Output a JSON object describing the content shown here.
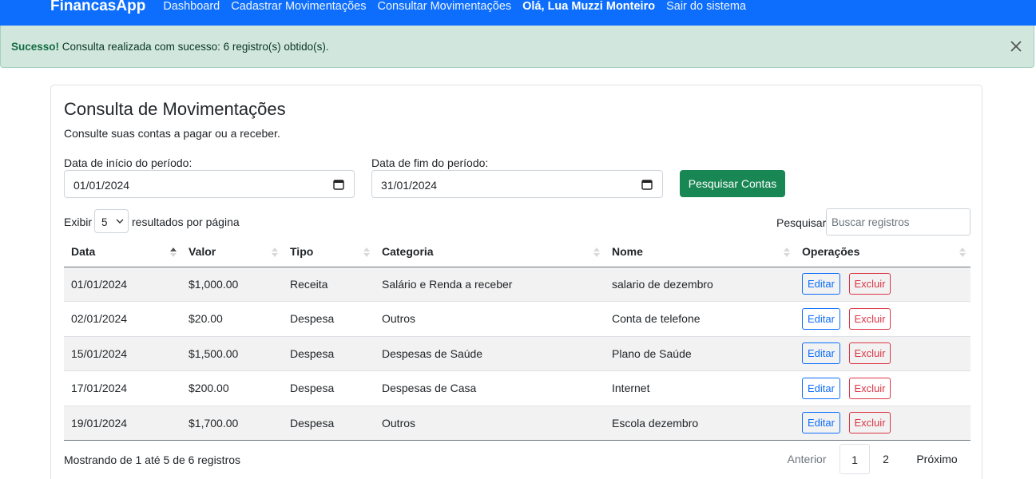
{
  "nav": {
    "brand": "FinancasApp",
    "links": [
      "Dashboard",
      "Cadastrar Movimentações",
      "Consultar Movimentações"
    ],
    "user": "Olá, Lua Muzzi Monteiro",
    "logout": "Sair do sistema"
  },
  "alert": {
    "strong": "Sucesso!",
    "text": " Consulta realizada com sucesso: 6 registro(s) obtido(s).",
    "close_icon": "close-icon"
  },
  "page": {
    "title": "Consulta de Movimentações",
    "subtitle": "Consulte suas contas a pagar ou a receber."
  },
  "filters": {
    "start_label": "Data de início do período:",
    "start_value": "01/01/2024",
    "end_label": "Data de fim do período:",
    "end_value": "31/01/2024",
    "search_button": "Pesquisar Contas",
    "calendar_icon": "calendar-icon"
  },
  "table_controls": {
    "show_label": "Exibir",
    "page_size": "5",
    "per_page_label": "resultados por página",
    "search_label": "Pesquisar",
    "search_placeholder": "Buscar registros"
  },
  "table": {
    "headers": [
      "Data",
      "Valor",
      "Tipo",
      "Categoria",
      "Nome",
      "Operações"
    ],
    "sorted_column": "Data",
    "rows": [
      {
        "data": "01/01/2024",
        "valor": "$1,000.00",
        "tipo": "Receita",
        "categoria": "Salário e Renda a receber",
        "nome": "salario de dezembro"
      },
      {
        "data": "02/01/2024",
        "valor": "$20.00",
        "tipo": "Despesa",
        "categoria": "Outros",
        "nome": "Conta de telefone"
      },
      {
        "data": "15/01/2024",
        "valor": "$1,500.00",
        "tipo": "Despesa",
        "categoria": "Despesas de Saúde",
        "nome": "Plano de Saúde"
      },
      {
        "data": "17/01/2024",
        "valor": "$200.00",
        "tipo": "Despesa",
        "categoria": "Despesas de Casa",
        "nome": "Internet"
      },
      {
        "data": "19/01/2024",
        "valor": "$1,700.00",
        "tipo": "Despesa",
        "categoria": "Outros",
        "nome": "Escola dezembro"
      }
    ],
    "edit_label": "Editar",
    "delete_label": "Excluir"
  },
  "footer": {
    "info": "Mostrando de 1 até 5 de 6 registros",
    "prev": "Anterior",
    "pages": [
      "1",
      "2"
    ],
    "current_page": "1",
    "next": "Próximo"
  },
  "colors": {
    "navbar": "#0d6efd",
    "alert_bg": "#d1e7dd",
    "search_button": "#198754",
    "edit": "#0d6efd",
    "delete": "#dc3545"
  }
}
